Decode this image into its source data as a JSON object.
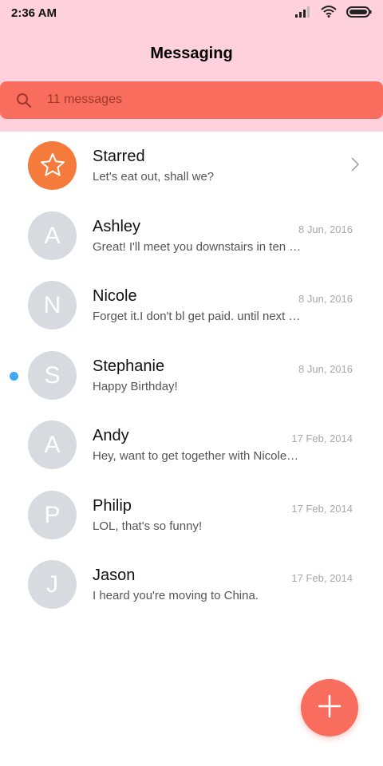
{
  "status_bar": {
    "time": "2:36 AM",
    "icons": [
      "signal-icon",
      "wifi-icon",
      "battery-icon"
    ]
  },
  "header": {
    "title": "Messaging",
    "background": "#ffd1dc"
  },
  "search": {
    "placeholder": "11 messages",
    "background": "#f86d5d"
  },
  "conversations": [
    {
      "name": "Starred",
      "preview": "Let's eat out, shall we?",
      "date": "",
      "avatar": "",
      "icon": "star-icon",
      "accent": "#f57b3d"
    },
    {
      "name": "Ashley",
      "preview": "Great! I'll meet you downstairs in ten …",
      "date": "8 Jun, 2016",
      "avatar": "A"
    },
    {
      "name": "Nicole",
      "preview": "Forget it.I don't bl get paid. until next …",
      "date": "8 Jun, 2016",
      "avatar": "N"
    },
    {
      "name": "Stephanie",
      "preview": "Happy Birthday!",
      "date": "8 Jun, 2016",
      "avatar": "S",
      "unread": true
    },
    {
      "name": "Andy",
      "preview": "Hey, want to get together with Nicole…",
      "date": "17 Feb, 2014",
      "avatar": "A"
    },
    {
      "name": "Philip",
      "preview": "LOL, that's so funny!",
      "date": "17 Feb, 2014",
      "avatar": "P"
    },
    {
      "name": "Jason",
      "preview": "I heard you're moving to China.",
      "date": "17 Feb, 2014",
      "avatar": "J"
    }
  ],
  "fab": {
    "icon": "plus-icon",
    "color": "#f86d5d"
  }
}
